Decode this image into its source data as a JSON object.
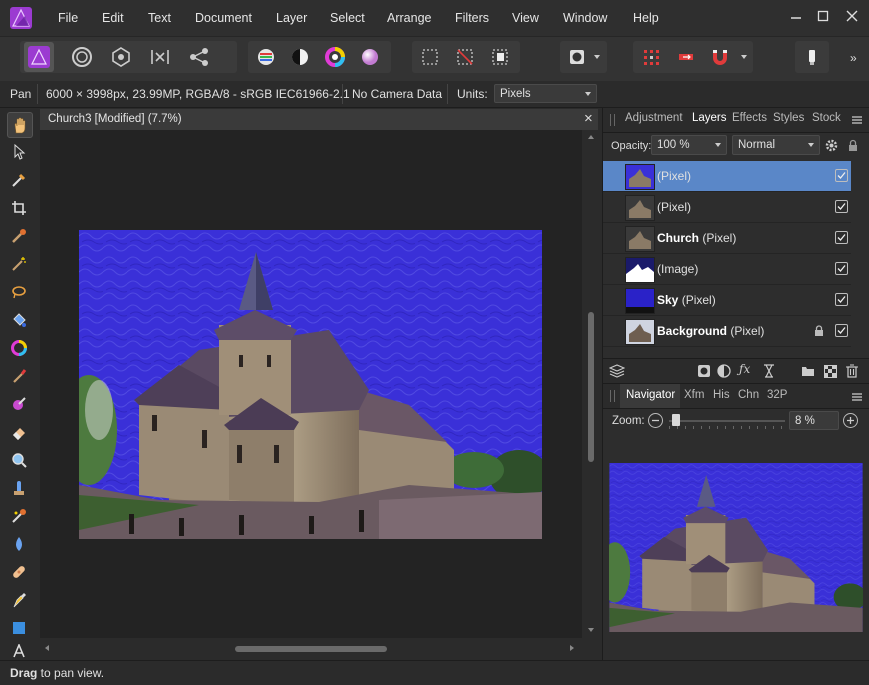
{
  "menu": {
    "items": [
      "File",
      "Edit",
      "Text",
      "Document",
      "Layer",
      "Select",
      "Arrange",
      "Filters",
      "View",
      "Window",
      "Help"
    ]
  },
  "context": {
    "tool_name": "Pan",
    "doc_info": "6000 × 3998px, 23.99MP, RGBA/8 - sRGB IEC61966-2.1",
    "camera": "No Camera Data",
    "units_label": "Units:",
    "units_value": "Pixels"
  },
  "document": {
    "tab_title": "Church3 [Modified] (7.7%)",
    "close_glyph": "×"
  },
  "panel_tabs": {
    "top": [
      "Adjustment",
      "Layers",
      "Effects",
      "Styles",
      "Stock"
    ],
    "top_active": "Layers",
    "bottom": [
      "Navigator",
      "Xfm",
      "His",
      "Chn",
      "32P"
    ],
    "bottom_active": "Navigator"
  },
  "layers_panel": {
    "opacity_label": "Opacity:",
    "opacity_value": "100 %",
    "blend_mode": "Normal",
    "layers": [
      {
        "bold": "",
        "type": "(Pixel)",
        "selected": true,
        "locked": false,
        "visible": true,
        "thumb": "church"
      },
      {
        "bold": "",
        "type": "(Pixel)",
        "selected": false,
        "locked": false,
        "visible": true,
        "thumb": "church"
      },
      {
        "bold": "Church",
        "type": " (Pixel)",
        "selected": false,
        "locked": false,
        "visible": true,
        "thumb": "church"
      },
      {
        "bold": "",
        "type": "(Image)",
        "selected": false,
        "locked": false,
        "visible": true,
        "thumb": "mountain"
      },
      {
        "bold": "Sky",
        "type": " (Pixel)",
        "selected": false,
        "locked": false,
        "visible": true,
        "thumb": "sky"
      },
      {
        "bold": "Background",
        "type": " (Pixel)",
        "selected": false,
        "locked": true,
        "visible": true,
        "thumb": "church-dark"
      }
    ]
  },
  "navigator": {
    "zoom_label": "Zoom:",
    "zoom_value": "8 %",
    "zoom_level": 0.08
  },
  "status": {
    "bold": "Drag",
    "text": " to pan view."
  },
  "colors": {
    "accent": "#5a87c8",
    "sky": "#3a2fd6",
    "logo": "#9b3bd1"
  },
  "icons": [
    "affinity-photo-logo",
    "pan-tool-icon",
    "move-tool-icon",
    "color-picker-icon",
    "crop-icon",
    "brush-icon",
    "magic-wand-icon",
    "lasso-icon",
    "fill-icon",
    "color-wheel-icon",
    "paint-brush-icon",
    "mixer-brush-icon",
    "eraser-icon",
    "dodge-icon",
    "clone-icon",
    "healing-icon",
    "blur-icon",
    "patch-icon",
    "pen-icon",
    "rectangle-icon",
    "text-tool-icon"
  ]
}
